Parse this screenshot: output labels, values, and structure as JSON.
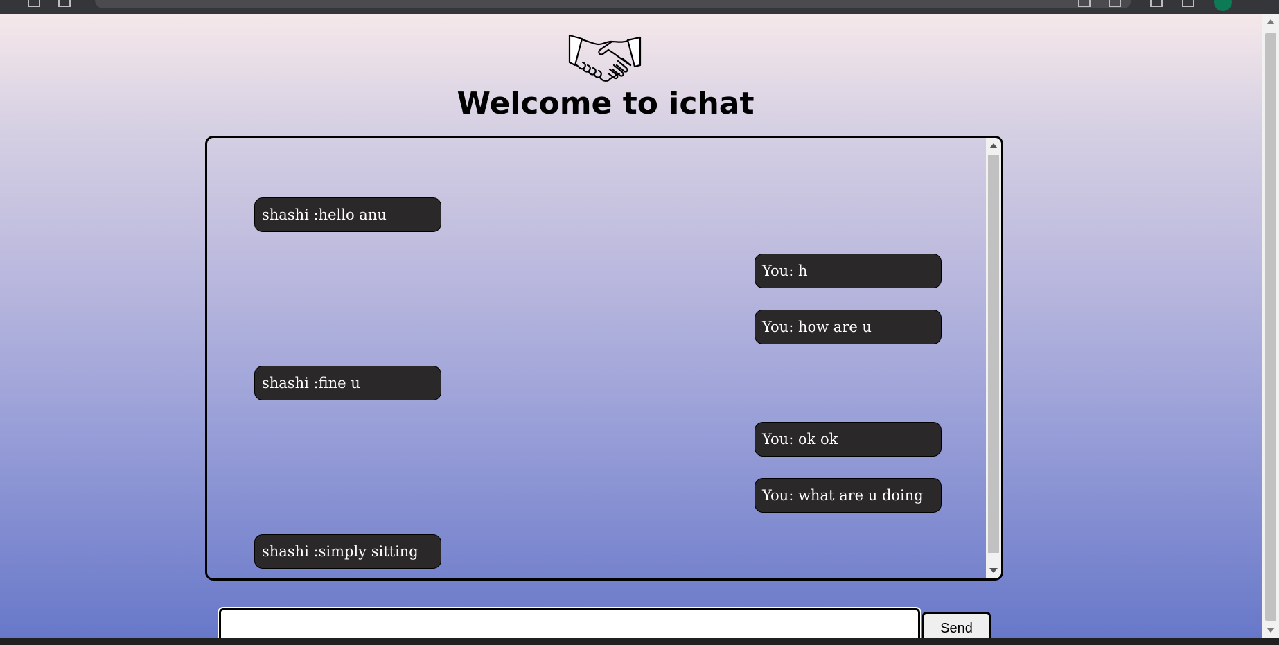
{
  "app": {
    "title": "Welcome to ichat"
  },
  "header": {
    "logo_icon": "handshake-icon"
  },
  "chat": {
    "messages": [
      {
        "text": "shashi :hello anu",
        "side": "left"
      },
      {
        "text": "You: h",
        "side": "right"
      },
      {
        "text": "You: how are u",
        "side": "right"
      },
      {
        "text": "shashi :fine u",
        "side": "left"
      },
      {
        "text": "You: ok ok",
        "side": "right"
      },
      {
        "text": "You: what are u doing",
        "side": "right"
      },
      {
        "text": "shashi :simply sitting",
        "side": "left"
      }
    ]
  },
  "compose": {
    "value": "",
    "send_label": "Send"
  },
  "colors": {
    "bubble": "#2a2829",
    "bubble_text": "#ffffff",
    "gradient_top": "#f5e8ea",
    "gradient_bottom": "#6878c9"
  }
}
